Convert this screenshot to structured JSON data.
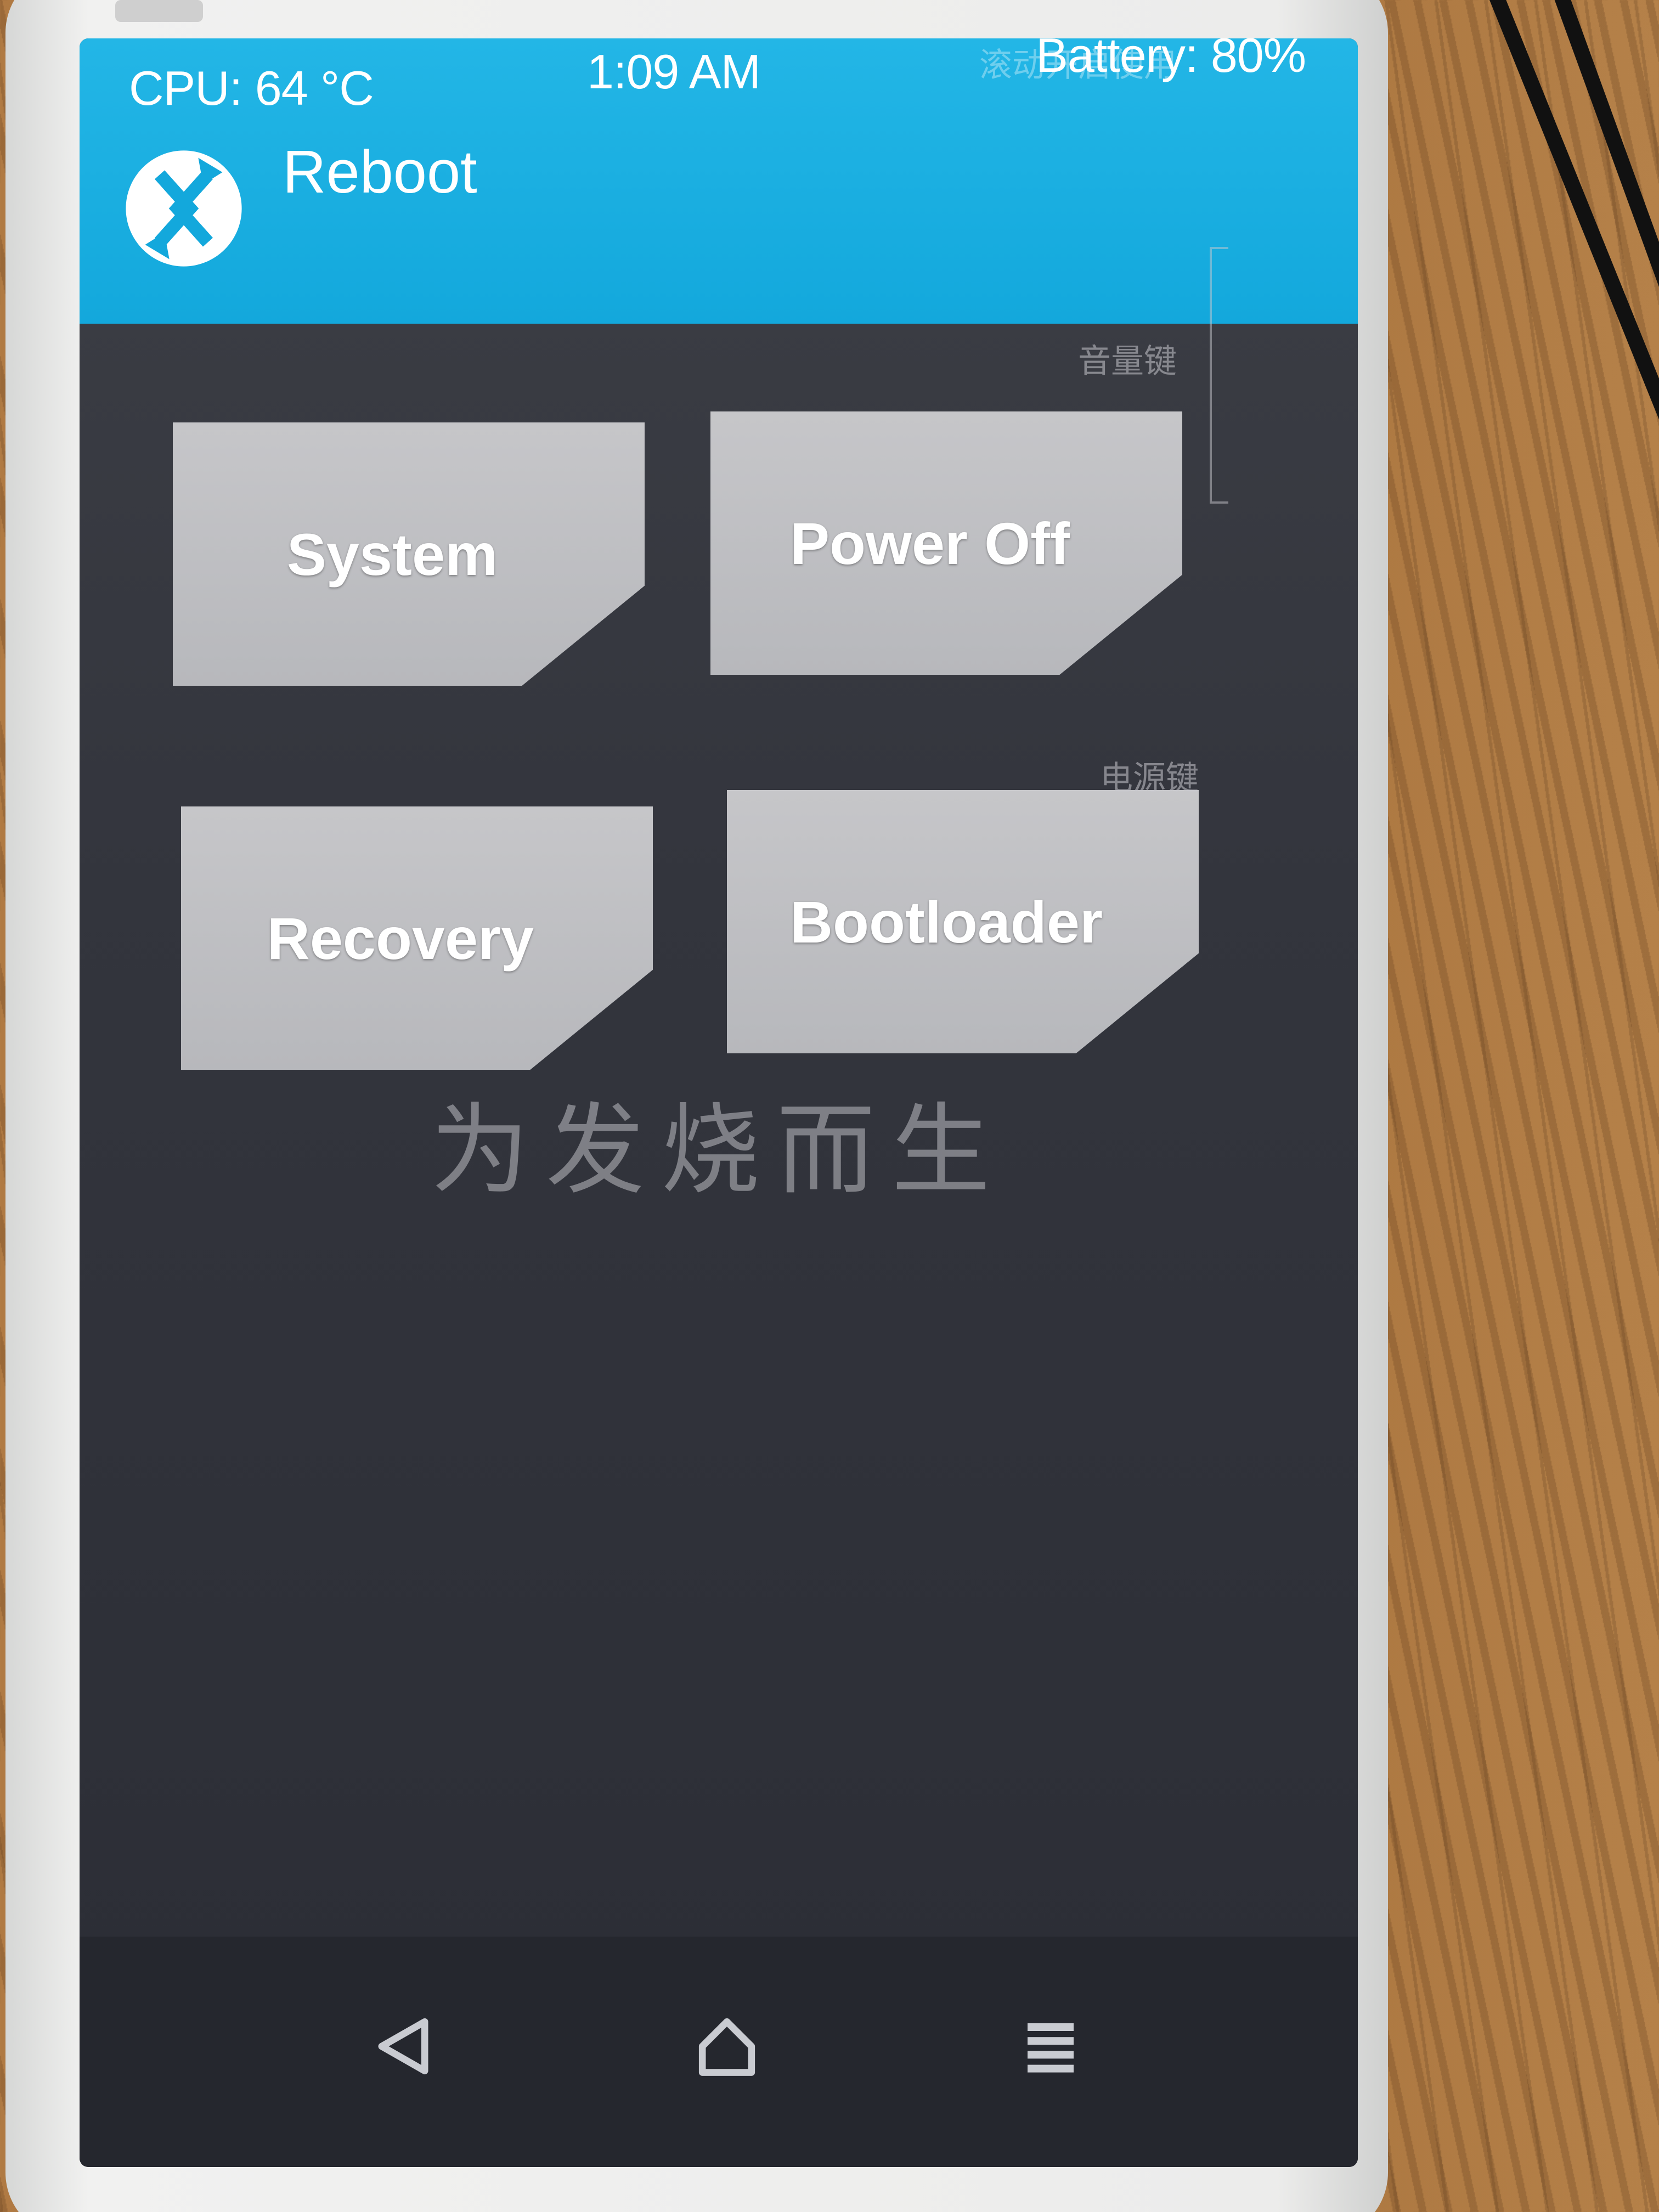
{
  "status_bar": {
    "cpu": "CPU: 64 °C",
    "time": "1:09 AM",
    "battery": "Battery: 80%"
  },
  "header": {
    "title": "Reboot",
    "logo_icon": "twrp-logo-icon"
  },
  "buttons": {
    "system": "System",
    "power_off": "Power Off",
    "recovery": "Recovery",
    "bootloader": "Bootloader"
  },
  "overlay_text": {
    "slogan": "为发烧而生",
    "volume_key": "音量键",
    "power_key": "电源键",
    "screen_tip": "滚动开启使用"
  },
  "nav_bar": {
    "back_icon": "back-triangle-icon",
    "home_icon": "home-icon",
    "menu_icon": "menu-lines-icon"
  },
  "colors": {
    "header": "#13a8dc",
    "background": "#33353d",
    "button": "#bcbcc0",
    "text": "#ffffff"
  }
}
